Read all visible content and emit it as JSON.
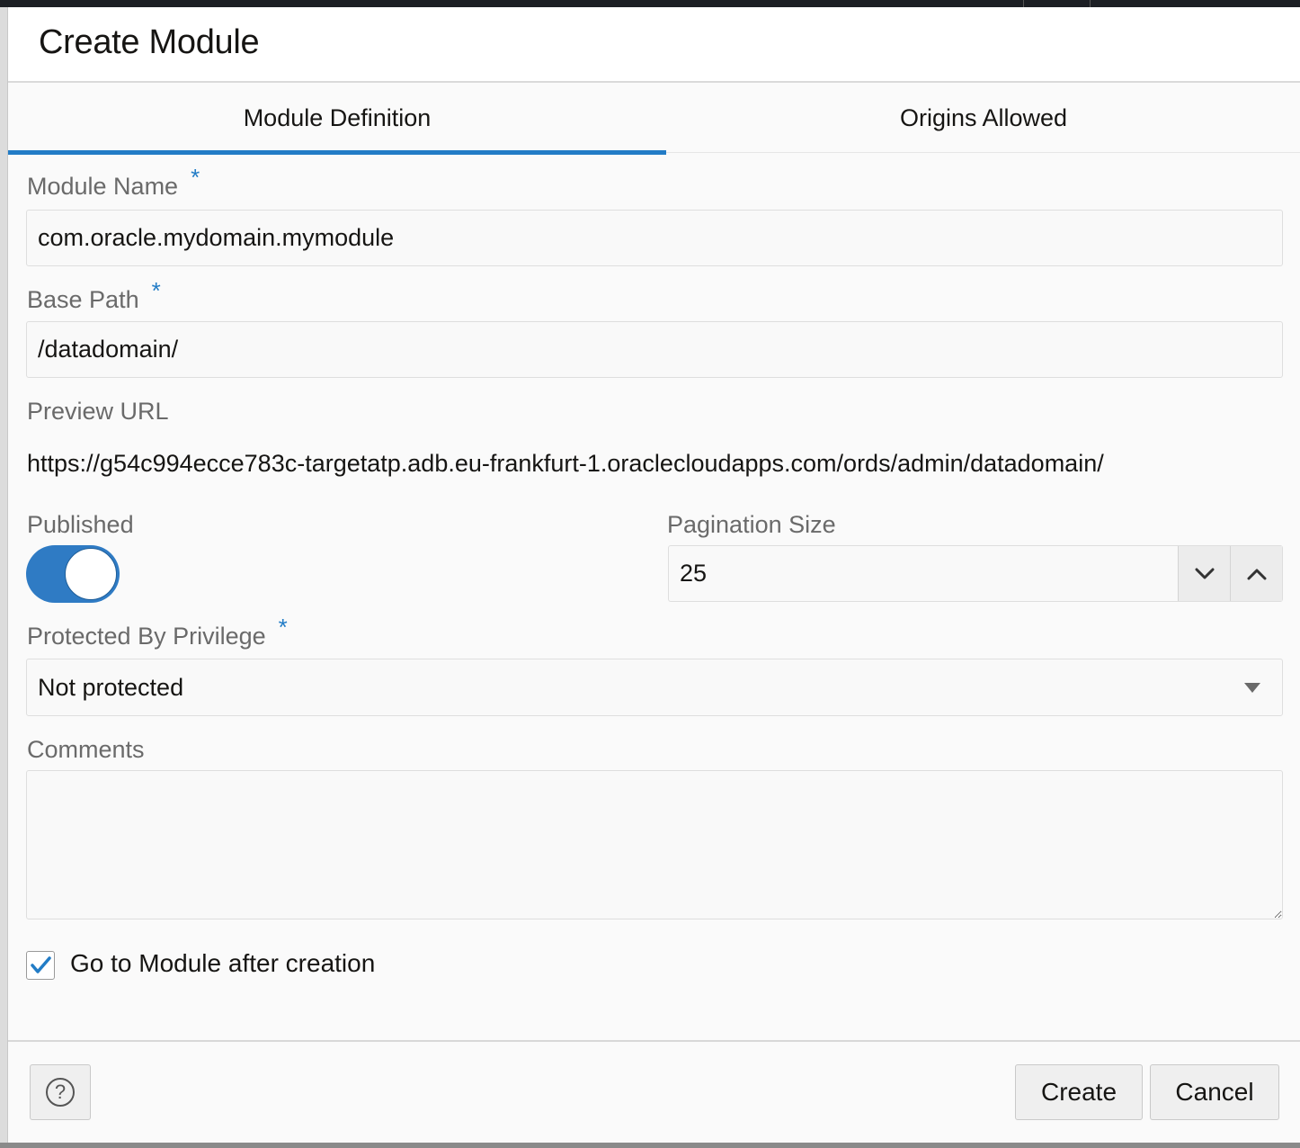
{
  "dialog": {
    "title": "Create Module"
  },
  "tabs": [
    {
      "label": "Module Definition",
      "active": true
    },
    {
      "label": "Origins Allowed",
      "active": false
    }
  ],
  "form": {
    "module_name": {
      "label": "Module Name",
      "required_mark": "*",
      "value": "com.oracle.mydomain.mymodule"
    },
    "base_path": {
      "label": "Base Path",
      "required_mark": "*",
      "value": "/datadomain/"
    },
    "preview_url": {
      "label": "Preview URL",
      "value": "https://g54c994ecce783c-targetatp.adb.eu-frankfurt-1.oraclecloudapps.com/ords/admin/datadomain/"
    },
    "published": {
      "label": "Published",
      "on": true
    },
    "pagination_size": {
      "label": "Pagination Size",
      "value": "25"
    },
    "protected_by_privilege": {
      "label": "Protected By Privilege",
      "required_mark": "*",
      "value": "Not protected"
    },
    "comments": {
      "label": "Comments",
      "value": ""
    },
    "go_to_module": {
      "label": "Go to Module after creation",
      "checked": true
    }
  },
  "footer": {
    "help_icon": "question-circle-icon",
    "create_label": "Create",
    "cancel_label": "Cancel"
  },
  "colors": {
    "accent": "#227cc6",
    "toggle_on": "#2f7bc4"
  }
}
